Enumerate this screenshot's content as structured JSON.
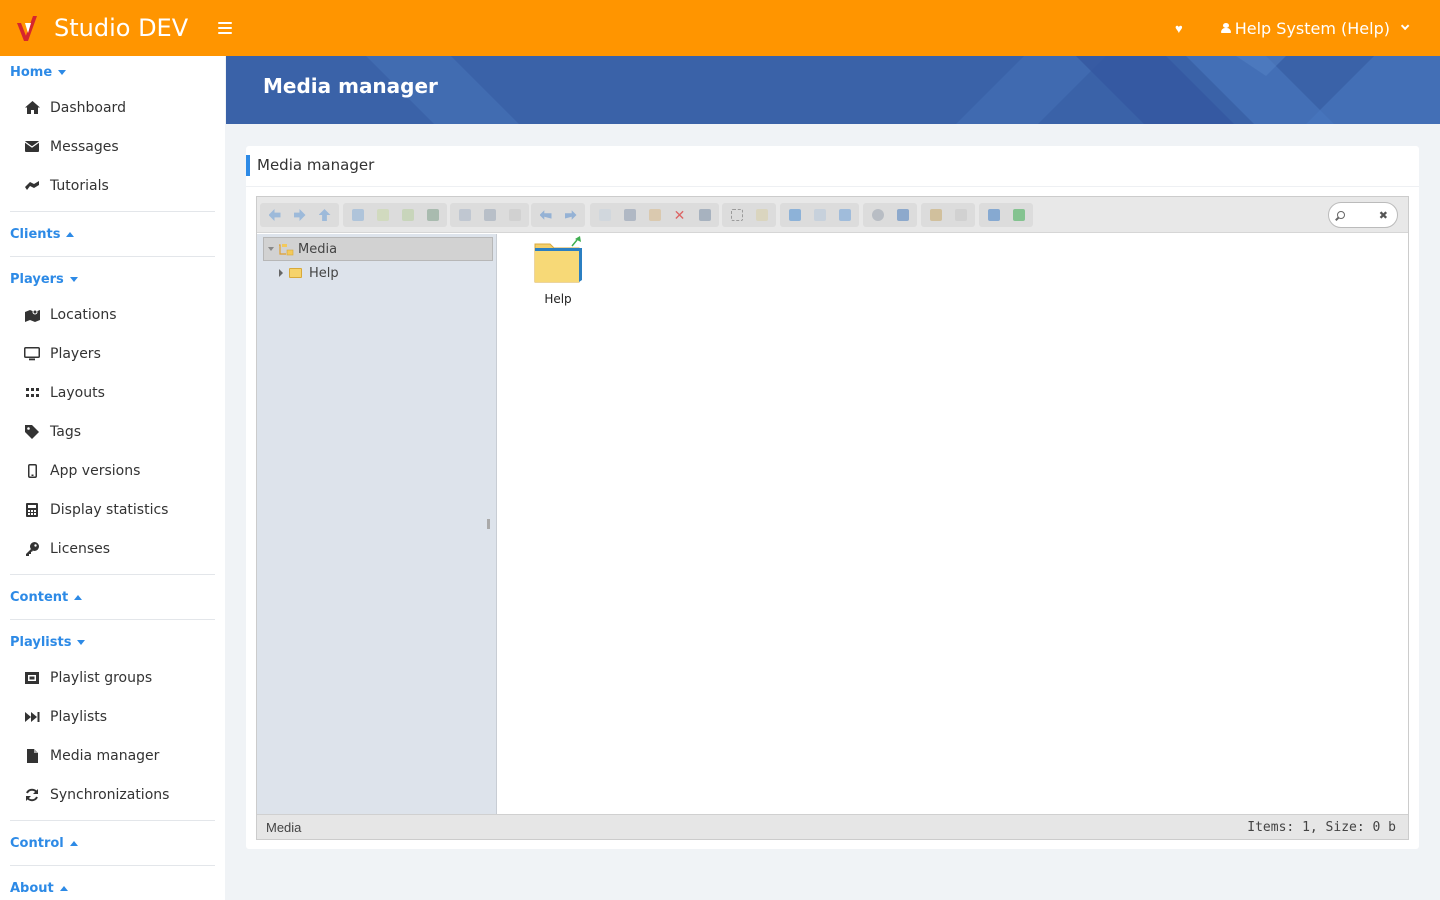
{
  "app": {
    "brand": "Studio DEV"
  },
  "header": {
    "user_label": "Help System (Help)"
  },
  "sidebar": {
    "sections": [
      {
        "label": "Home",
        "expanded": true,
        "items": [
          {
            "label": "Dashboard",
            "icon": "home-icon"
          },
          {
            "label": "Messages",
            "icon": "envelope-icon"
          },
          {
            "label": "Tutorials",
            "icon": "tutorial-icon"
          }
        ]
      },
      {
        "label": "Clients",
        "expanded": false,
        "items": []
      },
      {
        "label": "Players",
        "expanded": true,
        "items": [
          {
            "label": "Locations",
            "icon": "map-icon"
          },
          {
            "label": "Players",
            "icon": "monitor-icon"
          },
          {
            "label": "Layouts",
            "icon": "grid-icon"
          },
          {
            "label": "Tags",
            "icon": "tag-icon"
          },
          {
            "label": "App versions",
            "icon": "mobile-icon"
          },
          {
            "label": "Display statistics",
            "icon": "calculator-icon"
          },
          {
            "label": "Licenses",
            "icon": "key-icon"
          }
        ]
      },
      {
        "label": "Content",
        "expanded": false,
        "items": []
      },
      {
        "label": "Playlists",
        "expanded": true,
        "items": [
          {
            "label": "Playlist groups",
            "icon": "group-icon"
          },
          {
            "label": "Playlists",
            "icon": "fast-forward-icon"
          },
          {
            "label": "Media manager",
            "icon": "file-icon"
          },
          {
            "label": "Synchronizations",
            "icon": "refresh-icon"
          }
        ]
      },
      {
        "label": "Control",
        "expanded": false,
        "items": []
      },
      {
        "label": "About",
        "expanded": false,
        "items": []
      }
    ]
  },
  "page": {
    "title": "Media manager",
    "card_title": "Media manager"
  },
  "media_manager": {
    "search": {
      "value": ""
    },
    "tree": {
      "root": "Media",
      "children": [
        "Help"
      ]
    },
    "files": [
      {
        "name": "Help",
        "type": "folder"
      }
    ],
    "status": {
      "path": "Media",
      "info": "Items: 1, Size: 0 b"
    }
  },
  "colors": {
    "topbar": "#ff9500",
    "accent": "#2d8ae6",
    "banner": "#3a62a8"
  }
}
